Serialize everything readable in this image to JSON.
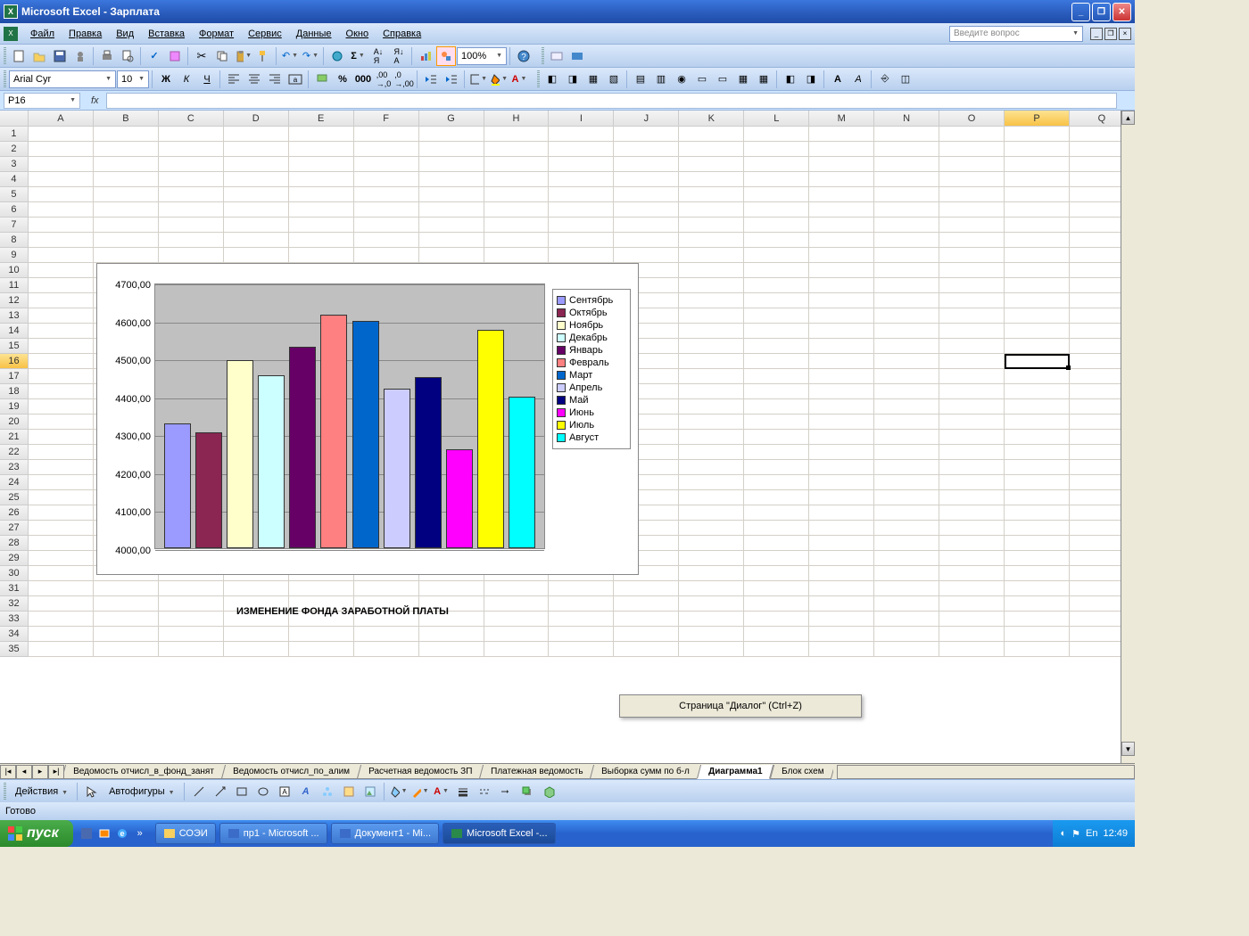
{
  "window": {
    "title": "Microsoft Excel - Зарплата"
  },
  "menubar": {
    "items": [
      "Файл",
      "Правка",
      "Вид",
      "Вставка",
      "Формат",
      "Сервис",
      "Данные",
      "Окно",
      "Справка"
    ],
    "question_placeholder": "Введите вопрос"
  },
  "toolbar_std": {
    "zoom": "100%"
  },
  "format_bar": {
    "font": "Arial Cyr",
    "size": "10"
  },
  "formula_bar": {
    "name_box": "P16",
    "fx": "fx",
    "formula": ""
  },
  "columns": [
    "A",
    "B",
    "C",
    "D",
    "E",
    "F",
    "G",
    "H",
    "I",
    "J",
    "K",
    "L",
    "M",
    "N",
    "O",
    "P",
    "Q"
  ],
  "row_count": 35,
  "selected_cell": "P16",
  "selected_col": "P",
  "selected_row": 16,
  "chart_title": "ИЗМЕНЕНИЕ ФОНДА ЗАРАБОТНОЙ ПЛАТЫ",
  "chart_data": {
    "type": "bar",
    "ylim": [
      4000,
      4700
    ],
    "yticks": [
      "4000,00",
      "4100,00",
      "4200,00",
      "4300,00",
      "4400,00",
      "4500,00",
      "4600,00",
      "4700,00"
    ],
    "series": [
      {
        "name": "Сентябрь",
        "value": 4330,
        "color": "#9b9bff"
      },
      {
        "name": "Октябрь",
        "value": 4305,
        "color": "#8a2651"
      },
      {
        "name": "Ноябрь",
        "value": 4495,
        "color": "#ffffcc"
      },
      {
        "name": "Декабрь",
        "value": 4455,
        "color": "#ccffff"
      },
      {
        "name": "Январь",
        "value": 4530,
        "color": "#660066"
      },
      {
        "name": "Февраль",
        "value": 4615,
        "color": "#ff8080"
      },
      {
        "name": "Март",
        "value": 4600,
        "color": "#0066cc"
      },
      {
        "name": "Апрель",
        "value": 4420,
        "color": "#ccccff"
      },
      {
        "name": "Май",
        "value": 4450,
        "color": "#000080"
      },
      {
        "name": "Июнь",
        "value": 4260,
        "color": "#ff00ff"
      },
      {
        "name": "Июль",
        "value": 4575,
        "color": "#ffff00"
      },
      {
        "name": "Август",
        "value": 4400,
        "color": "#00ffff"
      }
    ]
  },
  "tooltip": "Страница \"Диалог\" (Ctrl+Z)",
  "sheet_tabs": [
    {
      "label": "Ведомость отчисл_в_фонд_занят",
      "active": false
    },
    {
      "label": "Ведомость отчисл_по_алим",
      "active": false
    },
    {
      "label": "Расчетная ведомость ЗП",
      "active": false
    },
    {
      "label": "Платежная ведомость",
      "active": false
    },
    {
      "label": "Выборка сумм по б-л",
      "active": false
    },
    {
      "label": "Диаграмма1",
      "active": true
    },
    {
      "label": "Блок схем",
      "active": false
    }
  ],
  "drawing_bar": {
    "label_actions": "Действия",
    "label_autoshapes": "Автофигуры"
  },
  "status_bar": {
    "text": "Готово"
  },
  "taskbar": {
    "start": "пуск",
    "items": [
      {
        "label": "СОЭИ",
        "icon": "folder"
      },
      {
        "label": "пр1 - Microsoft ...",
        "icon": "word"
      },
      {
        "label": "Документ1 - Mi...",
        "icon": "word"
      },
      {
        "label": "Microsoft Excel -...",
        "icon": "excel",
        "active": true
      }
    ],
    "tray": {
      "lang": "En",
      "time": "12:49"
    }
  }
}
